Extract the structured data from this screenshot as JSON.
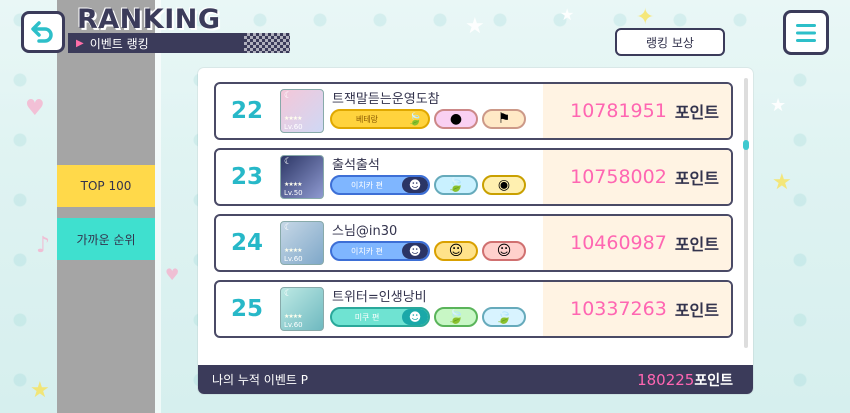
{
  "header": {
    "title": "RANKING",
    "subtitle": "이벤트 랭킹",
    "reward_button": "랭킹 보상"
  },
  "sidebar": {
    "tabs": [
      {
        "label": "TOP 100"
      },
      {
        "label": "가까운 순위"
      }
    ]
  },
  "rows": [
    {
      "rank": "22",
      "name": "트잭말듣는운영도참",
      "title_badge": "베테랑",
      "score": "10781951",
      "unit": "포인트",
      "avatar_level": "Lv.60"
    },
    {
      "rank": "23",
      "name": "출석출석",
      "title_badge": "이치카 편",
      "score": "10758002",
      "unit": "포인트",
      "avatar_level": "Lv.50"
    },
    {
      "rank": "24",
      "name": "스님@in30",
      "title_badge": "이치카 편",
      "score": "10460987",
      "unit": "포인트",
      "avatar_level": "Lv.60"
    },
    {
      "rank": "25",
      "name": "트위터=인생낭비",
      "title_badge": "미쿠 편",
      "score": "10337263",
      "unit": "포인트",
      "avatar_level": "Lv.60"
    }
  ],
  "footer": {
    "label": "나의 누적 이벤트 P",
    "value": "180225",
    "unit": "포인트"
  },
  "colors": {
    "accent_teal": "#27b8c8",
    "score_pink": "#ff66b2",
    "navy": "#3b3b5a",
    "yellow_tab": "#ffd94a",
    "teal_tab": "#3fe0cf"
  }
}
